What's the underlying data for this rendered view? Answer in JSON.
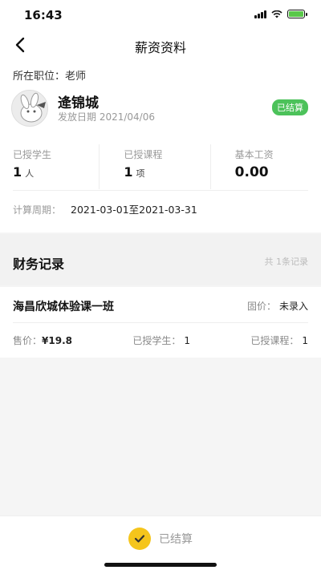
{
  "status_bar": {
    "time": "16:43"
  },
  "nav": {
    "title": "薪资资料",
    "back_icon": "chevron-left-icon"
  },
  "profile": {
    "position_label": "所在职位：",
    "position_value": "老师",
    "name": "逄锦城",
    "issue_date": "发放日期 2021/04/06",
    "badge": "已结算",
    "badge_color": "#4cc25a"
  },
  "stats": {
    "students_label": "已授学生",
    "students_value": "1",
    "students_unit": "人",
    "courses_label": "已授课程",
    "courses_value": "1",
    "courses_unit": "项",
    "base_salary_label": "基本工资",
    "base_salary_value": "0.00"
  },
  "period": {
    "label": "计算周期：",
    "value": "2021-03-01至2021-03-31"
  },
  "finance": {
    "title": "财务记录",
    "count": "共 1条记录",
    "records": [
      {
        "course": "海昌欣城体验课一班",
        "fixed_label": "固价：",
        "fixed_value": "未录入",
        "price_label": "售价：",
        "price_value": "¥19.8",
        "students_label": "已授学生：",
        "students_value": "1",
        "courses_label": "已授课程：",
        "courses_value": "1"
      }
    ]
  },
  "bottom": {
    "status_text": "已结算",
    "check_color": "#f5c51c"
  }
}
